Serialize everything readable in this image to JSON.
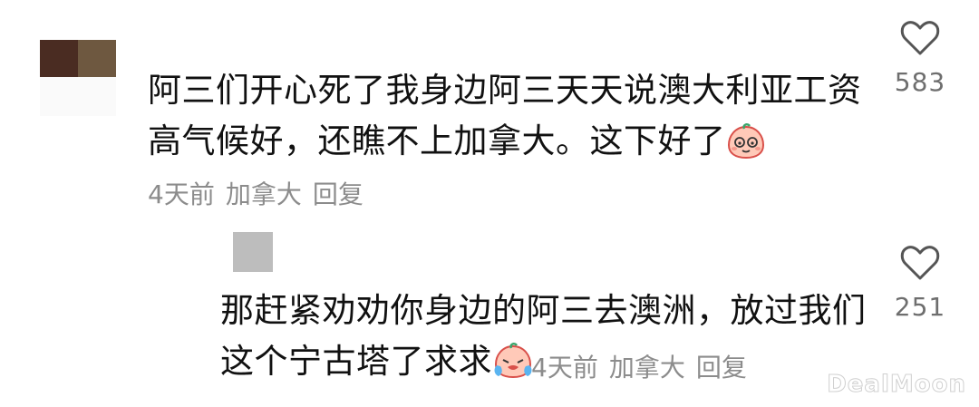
{
  "comment": {
    "text_line1": "阿三们开心死了我身边阿三天天说澳大利亚工资",
    "text_line2": "高气候好，还瞧不上加拿大。这下好了",
    "time": "4天前",
    "location": "加拿大",
    "reply_label": "回复",
    "like_count": "583",
    "emoji_icon": "peach-cute-emoji-icon"
  },
  "reply": {
    "text_line1": "那赶紧劝劝你身边的阿三去澳洲，放过我们",
    "text_line2": "这个宁古塔了求求",
    "time": "4天前",
    "location": "加拿大",
    "reply_label": "回复",
    "like_count": "251",
    "emoji_icon": "peach-crying-emoji-icon"
  },
  "watermark": "DealMoon",
  "colors": {
    "text": "#111111",
    "meta": "#8c8c8c",
    "like": "#6e6e6e"
  }
}
